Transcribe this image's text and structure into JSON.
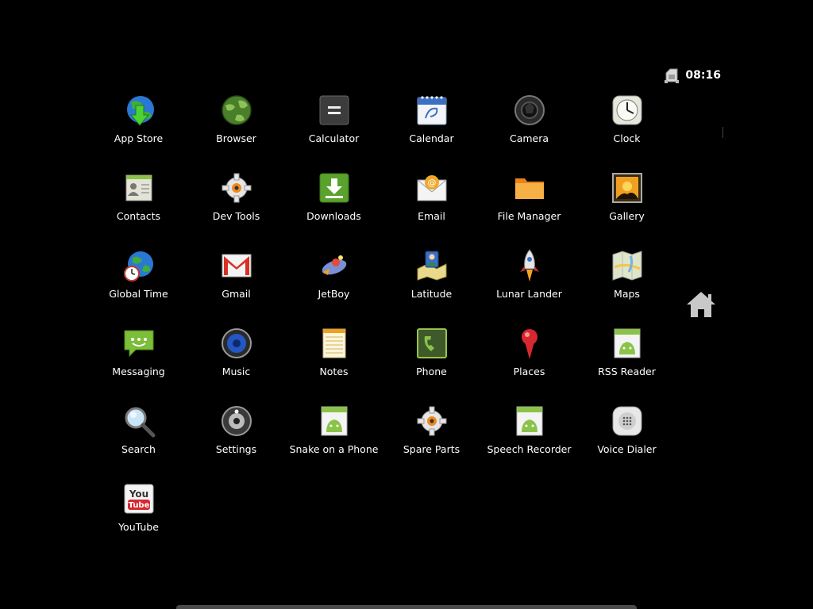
{
  "status_bar": {
    "time": "08:16",
    "sim_icon": "sim-card-icon"
  },
  "apps": [
    {
      "label": "App Store",
      "icon": "app-store-icon"
    },
    {
      "label": "Browser",
      "icon": "browser-icon"
    },
    {
      "label": "Calculator",
      "icon": "calculator-icon"
    },
    {
      "label": "Calendar",
      "icon": "calendar-icon"
    },
    {
      "label": "Camera",
      "icon": "camera-icon"
    },
    {
      "label": "Clock",
      "icon": "clock-icon"
    },
    {
      "label": "Contacts",
      "icon": "contacts-icon"
    },
    {
      "label": "Dev Tools",
      "icon": "dev-tools-icon"
    },
    {
      "label": "Downloads",
      "icon": "downloads-icon"
    },
    {
      "label": "Email",
      "icon": "email-icon"
    },
    {
      "label": "File Manager",
      "icon": "file-manager-icon"
    },
    {
      "label": "Gallery",
      "icon": "gallery-icon"
    },
    {
      "label": "Global Time",
      "icon": "global-time-icon"
    },
    {
      "label": "Gmail",
      "icon": "gmail-icon"
    },
    {
      "label": "JetBoy",
      "icon": "jetboy-icon"
    },
    {
      "label": "Latitude",
      "icon": "latitude-icon"
    },
    {
      "label": "Lunar Lander",
      "icon": "lunar-lander-icon"
    },
    {
      "label": "Maps",
      "icon": "maps-icon"
    },
    {
      "label": "Messaging",
      "icon": "messaging-icon"
    },
    {
      "label": "Music",
      "icon": "music-icon"
    },
    {
      "label": "Notes",
      "icon": "notes-icon"
    },
    {
      "label": "Phone",
      "icon": "phone-icon"
    },
    {
      "label": "Places",
      "icon": "places-icon"
    },
    {
      "label": "RSS Reader",
      "icon": "rss-reader-icon"
    },
    {
      "label": "Search",
      "icon": "search-icon"
    },
    {
      "label": "Settings",
      "icon": "settings-icon"
    },
    {
      "label": "Snake on a Phone",
      "icon": "snake-icon"
    },
    {
      "label": "Spare Parts",
      "icon": "spare-parts-icon"
    },
    {
      "label": "Speech Recorder",
      "icon": "speech-recorder-icon"
    },
    {
      "label": "Voice Dialer",
      "icon": "voice-dialer-icon"
    },
    {
      "label": "YouTube",
      "icon": "youtube-icon"
    }
  ],
  "home_button": {
    "icon": "home-icon"
  },
  "colors": {
    "background": "#000000",
    "text": "#ffffff",
    "android_green": "#8bc34a"
  }
}
